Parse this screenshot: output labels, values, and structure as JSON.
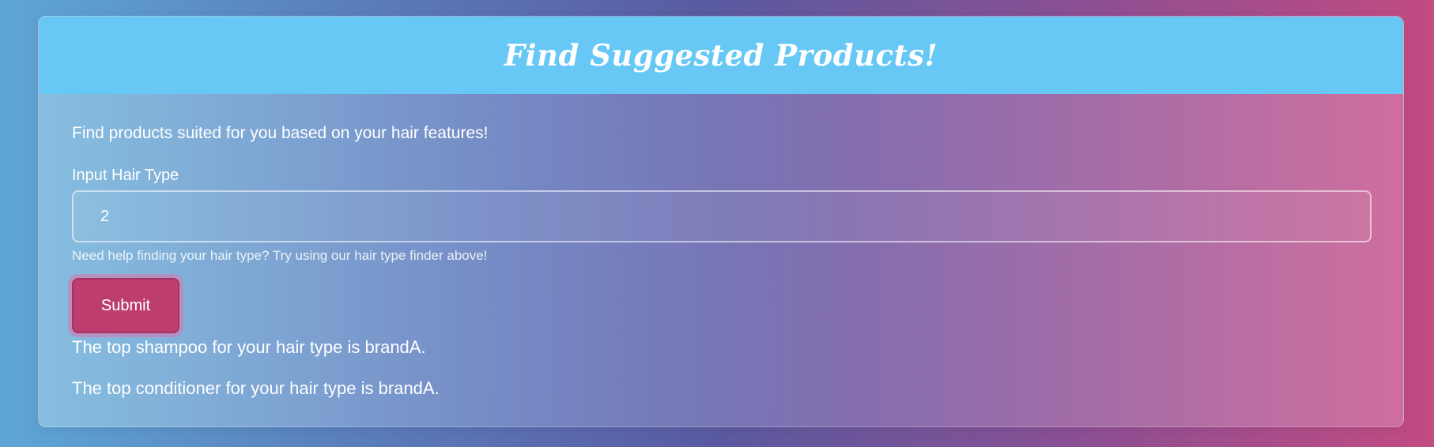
{
  "card": {
    "title": "Find Suggested Products!"
  },
  "form": {
    "intro": "Find products suited for you based on your hair features!",
    "hair_type_label": "Input Hair Type",
    "hair_type_value": "2",
    "help_text": "Need help finding your hair type? Try using our hair type finder above!",
    "submit_label": "Submit"
  },
  "results": {
    "shampoo": "The top shampoo for your hair type is brandA.",
    "conditioner": "The top conditioner for your hair type is brandA."
  },
  "colors": {
    "header": "#67c8f5",
    "button": "#bc3d6e"
  }
}
